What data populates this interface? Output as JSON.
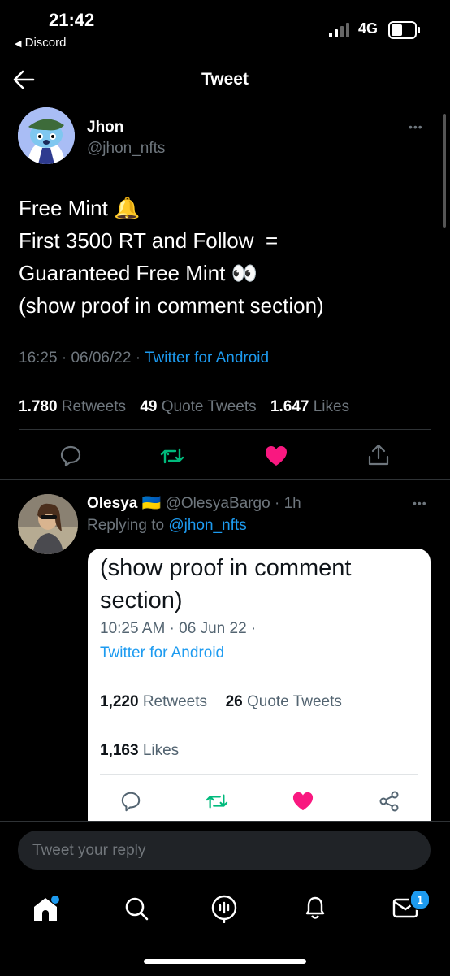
{
  "status_bar": {
    "time": "21:42",
    "back_app": "Discord",
    "network": "4G"
  },
  "header": {
    "title": "Tweet"
  },
  "tweet": {
    "author_name": "Jhon",
    "author_handle": "@jhon_nfts",
    "text_lines": [
      "Free Mint 🔔",
      "First 3500 RT and Follow  =",
      "Guaranteed Free Mint 👀",
      "(show proof in comment section)"
    ],
    "time": "16:25",
    "date": "06/06/22",
    "source": "Twitter for Android",
    "retweets": "1.780",
    "retweets_label": "Retweets",
    "quotes": "49",
    "quotes_label": "Quote Tweets",
    "likes": "1.647",
    "likes_label": "Likes"
  },
  "reply": {
    "author_name": "Olesya",
    "flag": "🇺🇦",
    "author_handle": "@OlesyaBargo",
    "time_ago": "1h",
    "replying_label": "Replying to",
    "replying_handle": "@jhon_nfts",
    "card": {
      "text_line1": "(show proof in comment",
      "text_line2": "section)",
      "time": "10:25 AM",
      "date": "06 Jun 22",
      "source": "Twitter for Android",
      "retweets": "1,220",
      "retweets_label": "Retweets",
      "quotes": "26",
      "quotes_label": "Quote Tweets",
      "likes": "1,163",
      "likes_label": "Likes"
    }
  },
  "composer": {
    "placeholder": "Tweet your reply"
  },
  "tabbar": {
    "messages_badge": "1"
  },
  "colors": {
    "accent": "#1d9bf0",
    "like": "#f91880",
    "retweet": "#00ba7c",
    "muted": "#6e767d"
  },
  "icons": [
    "back-arrow-icon",
    "more-icon",
    "reply-icon",
    "retweet-icon",
    "like-icon",
    "share-icon",
    "home-icon",
    "search-icon",
    "spaces-icon",
    "notifications-icon",
    "messages-icon"
  ]
}
